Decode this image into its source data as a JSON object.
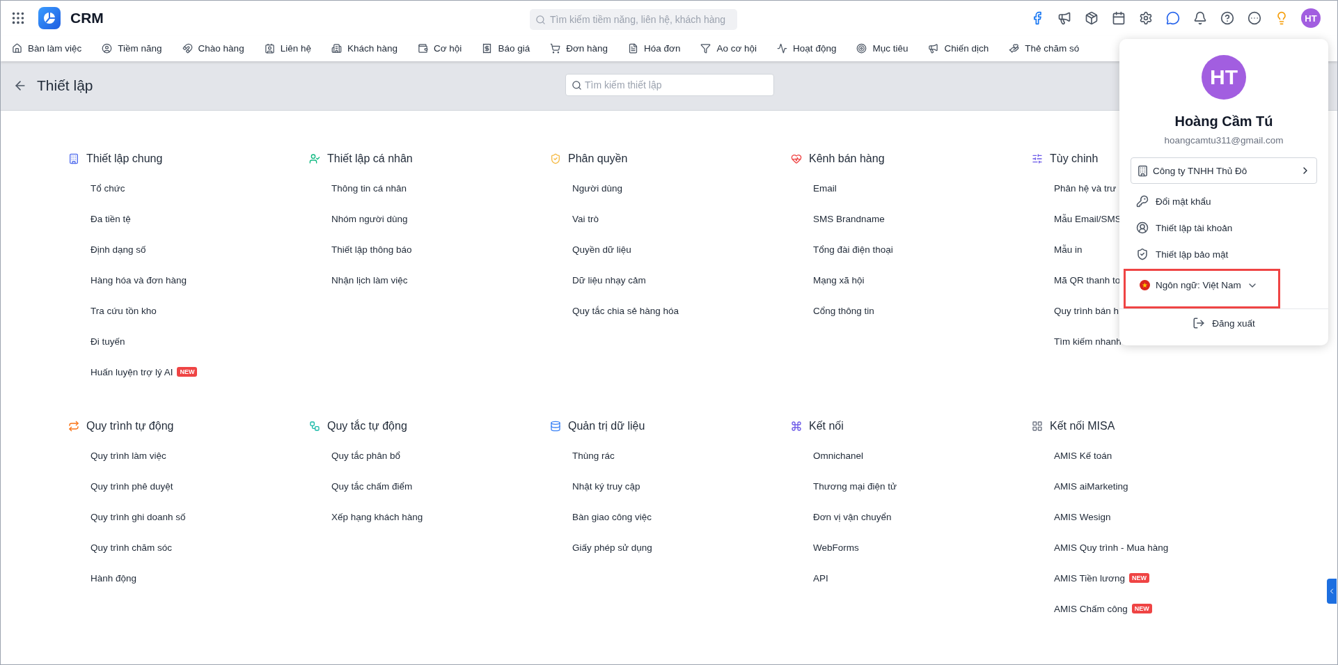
{
  "app": {
    "name": "CRM",
    "search_placeholder": "Tìm kiếm tiềm năng, liên hệ, khách hàng",
    "avatar": "HT"
  },
  "nav": [
    {
      "label": "Bàn làm việc"
    },
    {
      "label": "Tiềm năng"
    },
    {
      "label": "Chào hàng"
    },
    {
      "label": "Liên hệ"
    },
    {
      "label": "Khách hàng"
    },
    {
      "label": "Cơ hội"
    },
    {
      "label": "Báo giá"
    },
    {
      "label": "Đơn hàng"
    },
    {
      "label": "Hóa đơn"
    },
    {
      "label": "Ao cơ hội"
    },
    {
      "label": "Hoạt động"
    },
    {
      "label": "Mục tiêu"
    },
    {
      "label": "Chiến dịch"
    },
    {
      "label": "Thẻ chăm só"
    }
  ],
  "header": {
    "title": "Thiết lập",
    "search_placeholder": "Tìm kiếm thiết lập"
  },
  "groups": [
    {
      "sections": [
        {
          "title": "Thiết lập chung",
          "items": [
            {
              "label": "Tổ chức"
            },
            {
              "label": "Đa tiền tệ"
            },
            {
              "label": "Định dạng số"
            },
            {
              "label": "Hàng hóa và đơn hàng"
            },
            {
              "label": "Tra cứu tồn kho"
            },
            {
              "label": "Đi tuyến"
            },
            {
              "label": "Huấn luyện trợ lý AI",
              "badge": "NEW"
            }
          ]
        },
        {
          "title": "Thiết lập cá nhân",
          "items": [
            {
              "label": "Thông tin cá nhân"
            },
            {
              "label": "Nhóm người dùng"
            },
            {
              "label": "Thiết lập thông báo"
            },
            {
              "label": "Nhận lịch làm việc"
            }
          ]
        },
        {
          "title": "Phân quyền",
          "items": [
            {
              "label": "Người dùng"
            },
            {
              "label": "Vai trò"
            },
            {
              "label": "Quyền dữ liệu"
            },
            {
              "label": "Dữ liệu nhạy cảm"
            },
            {
              "label": "Quy tắc chia sẻ hàng hóa"
            }
          ]
        },
        {
          "title": "Kênh bán hàng",
          "items": [
            {
              "label": "Email"
            },
            {
              "label": "SMS Brandname"
            },
            {
              "label": "Tổng đài điện thoại"
            },
            {
              "label": "Mạng xã hội"
            },
            {
              "label": "Cổng thông tin"
            }
          ]
        },
        {
          "title": "Tùy chinh",
          "items": [
            {
              "label": "Phân hệ và trư"
            },
            {
              "label": "Mẫu Email/SMS"
            },
            {
              "label": "Mẫu in"
            },
            {
              "label": "Mã QR thanh to"
            },
            {
              "label": "Quy trình bán h"
            },
            {
              "label": "Tìm kiếm nhanh"
            }
          ]
        }
      ]
    },
    {
      "sections": [
        {
          "title": "Quy trình tự động",
          "items": [
            {
              "label": "Quy trình làm việc"
            },
            {
              "label": "Quy trình phê duyệt"
            },
            {
              "label": "Quy trình ghi doanh số"
            },
            {
              "label": "Quy trình chăm sóc"
            },
            {
              "label": "Hành động"
            }
          ]
        },
        {
          "title": "Quy tắc tự động",
          "items": [
            {
              "label": "Quy tắc phân bổ"
            },
            {
              "label": "Quy tắc chấm điểm"
            },
            {
              "label": "Xếp hạng khách hàng"
            }
          ]
        },
        {
          "title": "Quản trị dữ liệu",
          "items": [
            {
              "label": "Thùng rác"
            },
            {
              "label": "Nhật ký truy cập"
            },
            {
              "label": "Bàn giao công việc"
            },
            {
              "label": "Giấy phép sử dụng"
            }
          ]
        },
        {
          "title": "Kết nối",
          "items": [
            {
              "label": "Omnichanel"
            },
            {
              "label": "Thương mại điện tử"
            },
            {
              "label": "Đơn vị vận chuyển"
            },
            {
              "label": "WebForms"
            },
            {
              "label": "API"
            }
          ]
        },
        {
          "title": "Kết nối MISA",
          "items": [
            {
              "label": "AMIS Kế toán"
            },
            {
              "label": "AMIS aiMarketing"
            },
            {
              "label": "AMIS Wesign"
            },
            {
              "label": "AMIS Quy trình - Mua hàng"
            },
            {
              "label": "AMIS Tiền lương",
              "badge": "NEW"
            },
            {
              "label": "AMIS Chấm công",
              "badge": "NEW"
            }
          ]
        }
      ]
    }
  ],
  "profile": {
    "initials": "HT",
    "name": "Hoàng Cầm Tú",
    "email": "hoangcamtu311@gmail.com",
    "company": "Công ty TNHH Thủ Đô",
    "menu": [
      {
        "label": "Đổi mật khẩu"
      },
      {
        "label": "Thiết lập tài khoản"
      },
      {
        "label": "Thiết lập bảo mật"
      }
    ],
    "language": {
      "label": "Ngôn ngữ: Việt Nam",
      "highlighted": true
    },
    "logout": "Đăng xuất"
  }
}
